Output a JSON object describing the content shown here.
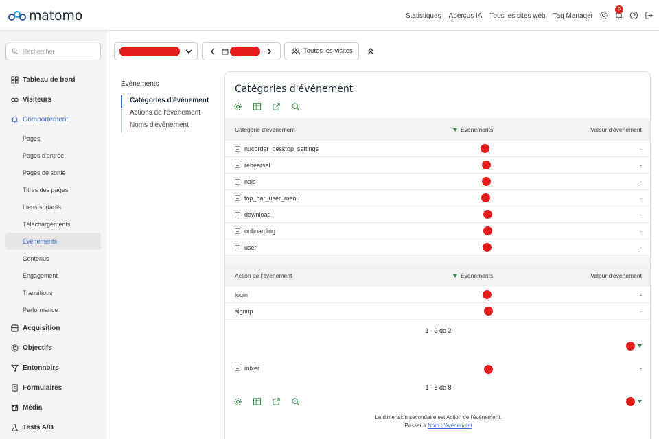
{
  "app": {
    "logo_text": "matomo"
  },
  "top_nav": {
    "links": [
      "Statistiques",
      "Aperçus IA",
      "Tous les sites web",
      "Tag Manager"
    ],
    "notification_count": "6"
  },
  "sidebar": {
    "search_placeholder": "Rechercher",
    "categories": [
      {
        "label": "Tableau de bord",
        "icon": "dashboard-icon"
      },
      {
        "label": "Visiteurs",
        "icon": "visitors-icon"
      },
      {
        "label": "Comportement",
        "icon": "bell-icon",
        "active": true,
        "subitems": [
          "Pages",
          "Pages d'entrée",
          "Pages de sortie",
          "Titres des pages",
          "Liens sortants",
          "Téléchargements",
          "Événements",
          "Contenus",
          "Engagement",
          "Transitions",
          "Performance"
        ],
        "active_subitem": "Événements"
      },
      {
        "label": "Acquisition",
        "icon": "acquisition-icon"
      },
      {
        "label": "Objectifs",
        "icon": "target-icon"
      },
      {
        "label": "Entonnoirs",
        "icon": "funnel-icon"
      },
      {
        "label": "Formulaires",
        "icon": "forms-icon"
      },
      {
        "label": "Média",
        "icon": "media-icon"
      },
      {
        "label": "Tests A/B",
        "icon": "flask-icon"
      }
    ]
  },
  "controls": {
    "segment_label": "Toutes les visites"
  },
  "report_menu": {
    "heading": "Événements",
    "items": [
      "Catégories d'événement",
      "Actions de l'événement",
      "Noms d'événement"
    ],
    "active": "Catégories d'événement"
  },
  "card": {
    "title": "Catégories d'événement",
    "table1": {
      "col_label": "Catégorie d'événement",
      "col_events": "Événements",
      "col_value": "Valeur d'événement",
      "rows": [
        {
          "label": "nucorder_desktop_settings",
          "value": "-",
          "expanded": false
        },
        {
          "label": "rehearsal",
          "value": "-",
          "expanded": false
        },
        {
          "label": "nals",
          "value": "-",
          "expanded": false
        },
        {
          "label": "top_bar_user_menu",
          "value": "-",
          "expanded": false
        },
        {
          "label": "download",
          "value": "-",
          "expanded": false
        },
        {
          "label": "onboarding",
          "value": "-",
          "expanded": false
        },
        {
          "label": "user",
          "value": "-",
          "expanded": true
        }
      ]
    },
    "subtable": {
      "col_label": "Action de l'événement",
      "col_events": "Événements",
      "col_value": "Valeur d'événement",
      "rows": [
        {
          "label": "login",
          "value": "-"
        },
        {
          "label": "signup",
          "value": "-"
        }
      ],
      "pagination": "1 - 2 de 2"
    },
    "table1_extra_row": {
      "label": "mixer",
      "value": "-"
    },
    "pagination": "1 - 8 de 8",
    "footnote_line1": "La dimension secondaire est Action de l'événement.",
    "footnote_prefix": "Passer à",
    "footnote_link": "Nom d'événement"
  },
  "colors": {
    "accent": "#3a6cc8",
    "tool_green": "#2e8a3e",
    "redaction": "#e41c1c"
  }
}
